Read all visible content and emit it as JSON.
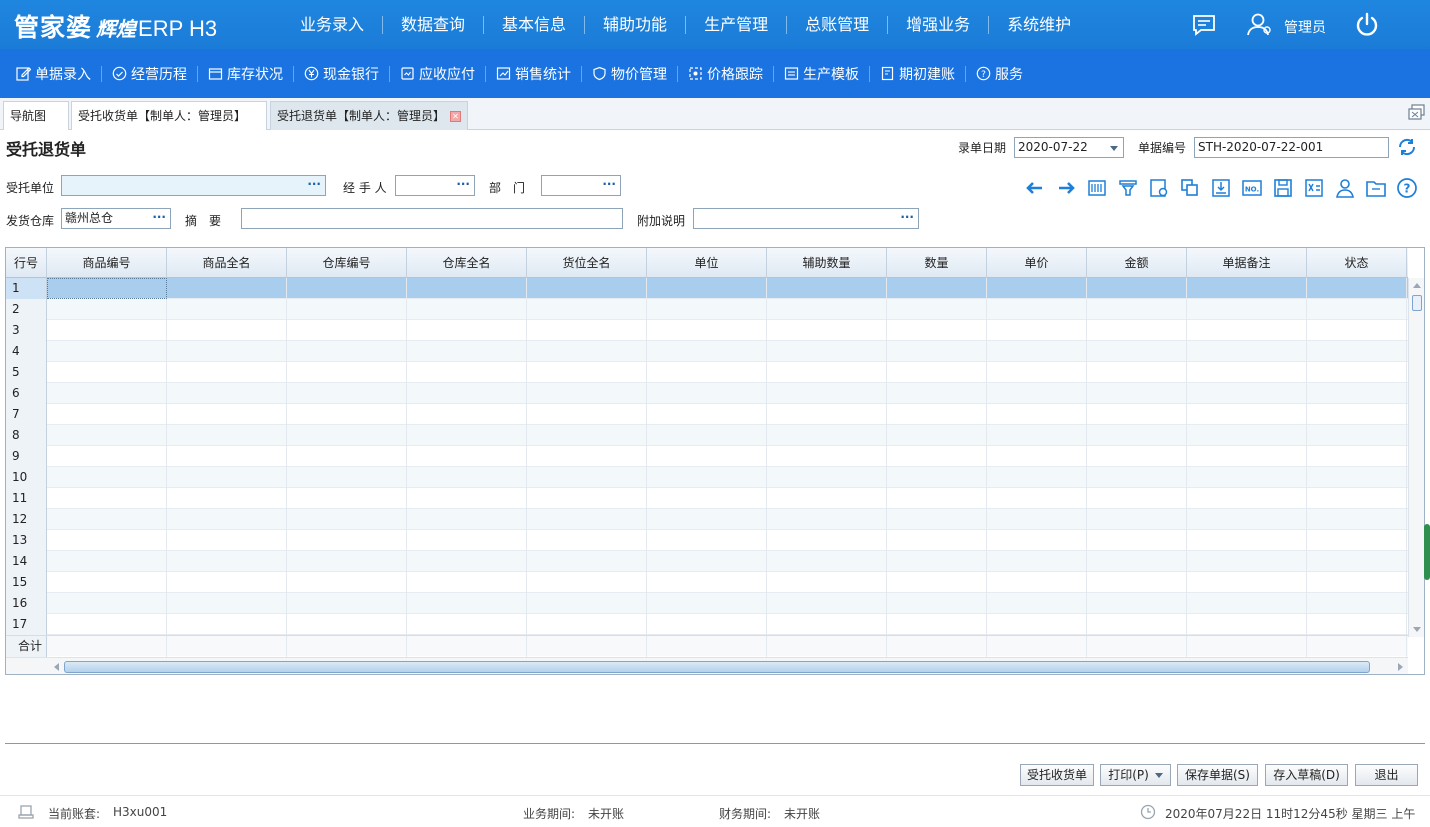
{
  "header": {
    "logo_main": "管家婆",
    "logo_sub": "辉煌",
    "logo_product": "ERP H3",
    "nav": [
      "业务录入",
      "数据查询",
      "基本信息",
      "辅助功能",
      "生产管理",
      "总账管理",
      "增强业务",
      "系统维护"
    ],
    "user_name": "管理员"
  },
  "toolbar": {
    "items": [
      {
        "label": "单据录入",
        "icon": "edit-icon"
      },
      {
        "label": "经营历程",
        "icon": "check-circle-icon"
      },
      {
        "label": "库存状况",
        "icon": "box-icon"
      },
      {
        "label": "现金银行",
        "icon": "yuan-icon"
      },
      {
        "label": "应收应付",
        "icon": "ledger-icon"
      },
      {
        "label": "销售统计",
        "icon": "chart-icon"
      },
      {
        "label": "物价管理",
        "icon": "shield-icon"
      },
      {
        "label": "价格跟踪",
        "icon": "track-icon"
      },
      {
        "label": "生产模板",
        "icon": "template-icon"
      },
      {
        "label": "期初建账",
        "icon": "book-icon"
      },
      {
        "label": "服务",
        "icon": "help-icon"
      }
    ]
  },
  "tabs": [
    {
      "label": "导航图"
    },
    {
      "label": "受托收货单【制单人：管理员】"
    },
    {
      "label": "受托退货单【制单人：管理员】"
    }
  ],
  "form": {
    "title": "受托退货单",
    "date_label": "录单日期",
    "date_value": "2020-07-22",
    "number_label": "单据编号",
    "number_value": "STH-2020-07-22-001",
    "client_label": "受托单位",
    "client_value": "",
    "handler_label": "经 手 人",
    "handler_value": "",
    "dept_label": "部　门",
    "dept_value": "",
    "warehouse_label": "发货仓库",
    "warehouse_value": "赣州总仓",
    "summary_label": "摘　要",
    "summary_value": "",
    "note_label": "附加说明",
    "note_value": ""
  },
  "grid": {
    "columns": [
      "行号",
      "商品编号",
      "商品全名",
      "仓库编号",
      "仓库全名",
      "货位全名",
      "单位",
      "辅助数量",
      "数量",
      "单价",
      "金额",
      "单据备注",
      "状态"
    ],
    "rows": [
      "1",
      "2",
      "3",
      "4",
      "5",
      "6",
      "7",
      "8",
      "9",
      "10",
      "11",
      "12",
      "13",
      "14",
      "15",
      "16",
      "17"
    ],
    "total_label": "合计"
  },
  "buttons": {
    "receive": "受托收货单",
    "print": "打印(P)",
    "save": "保存单据(S)",
    "draft": "存入草稿(D)",
    "exit": "退出"
  },
  "status": {
    "account_label": "当前账套:",
    "account_value": "H3xu001",
    "biz_period_label": "业务期间:",
    "biz_period_value": "未开账",
    "fin_period_label": "财务期间:",
    "fin_period_value": "未开账",
    "datetime": "2020年07月22日 11时12分45秒 星期三 上午"
  },
  "colors": {
    "header_blue": "#1f86df",
    "toolbar_blue": "#1a73e0",
    "icon_blue": "#1e7fd8",
    "selected_row": "#a9cdec"
  }
}
